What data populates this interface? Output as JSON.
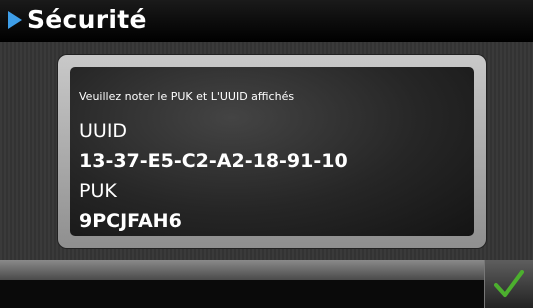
{
  "header": {
    "title": "Sécurité",
    "arrow_icon": "play-arrow-icon",
    "accent_color": "#3e9ee8"
  },
  "dialog": {
    "message": "Veuillez noter le PUK et L'UUID affichés",
    "uuid_label": "UUID",
    "uuid_value": "13-37-E5-C2-A2-18-91-10",
    "puk_label": "PUK",
    "puk_value": "9PCJFAH6"
  },
  "footer": {
    "confirm_icon": "checkmark-icon",
    "confirm_color": "#4caf2e"
  }
}
